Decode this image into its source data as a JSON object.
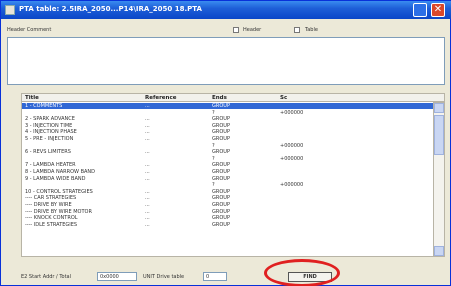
{
  "window": {
    "title": "PTA table: 2.5IRA_2050...P14\\IRA_2050 18.PTA",
    "close_glyph": "✕"
  },
  "header": {
    "comment_label": "Header Comment",
    "check1_label": "Header",
    "check2_label": "Table"
  },
  "table": {
    "columns": [
      "Title",
      "Reference",
      "Ends",
      "Sc"
    ],
    "rows": [
      {
        "title": "1 - COMMENTS",
        "ref": "...",
        "ends": "GROUP",
        "sc": "",
        "selected": true
      },
      {
        "title": "",
        "ref": "",
        "ends": "?",
        "sc": "+000000",
        "selected": false
      },
      {
        "title": "2 - SPARK ADVANCE",
        "ref": "...",
        "ends": "GROUP",
        "sc": "",
        "selected": false
      },
      {
        "title": "3 - INJECTION TIME",
        "ref": "...",
        "ends": "GROUP",
        "sc": "",
        "selected": false
      },
      {
        "title": "4 - INJECTION PHASE",
        "ref": "...",
        "ends": "GROUP",
        "sc": "",
        "selected": false
      },
      {
        "title": "5 - PRE - INJECTION",
        "ref": "...",
        "ends": "GROUP",
        "sc": "",
        "selected": false
      },
      {
        "title": "",
        "ref": "",
        "ends": "?",
        "sc": "+000000",
        "selected": false
      },
      {
        "title": "6 - REVS LIMITERS",
        "ref": "...",
        "ends": "GROUP",
        "sc": "",
        "selected": false
      },
      {
        "title": "",
        "ref": "",
        "ends": "?",
        "sc": "+000000",
        "selected": false
      },
      {
        "title": "7 - LAMBDA HEATER",
        "ref": "...",
        "ends": "GROUP",
        "sc": "",
        "selected": false
      },
      {
        "title": "8 - LAMBDA NARROW BAND",
        "ref": "...",
        "ends": "GROUP",
        "sc": "",
        "selected": false
      },
      {
        "title": "9 - LAMBDA WIDE BAND",
        "ref": "...",
        "ends": "GROUP",
        "sc": "",
        "selected": false
      },
      {
        "title": "",
        "ref": "",
        "ends": "?",
        "sc": "+000000",
        "selected": false
      },
      {
        "title": "10 - CONTROL STRATEGIES",
        "ref": "...",
        "ends": "GROUP",
        "sc": "",
        "selected": false
      },
      {
        "title": "---- CAR STRATEGIES",
        "ref": "...",
        "ends": "GROUP",
        "sc": "",
        "selected": false
      },
      {
        "title": "---- DRIVE BY WIRE",
        "ref": "...",
        "ends": "GROUP",
        "sc": "",
        "selected": false
      },
      {
        "title": "---- DRIVE BY WIRE MOTOR",
        "ref": "...",
        "ends": "GROUP",
        "sc": "",
        "selected": false
      },
      {
        "title": "---- KNOCK CONTROL",
        "ref": "...",
        "ends": "GROUP",
        "sc": "",
        "selected": false
      },
      {
        "title": "---- IDLE STRATEGIES",
        "ref": "...",
        "ends": "GROUP",
        "sc": "",
        "selected": false
      }
    ]
  },
  "footer": {
    "label1": "E2 Start Addr / Total",
    "input1": "0x0000",
    "label2": "UNIT Drive table",
    "input2": "0",
    "button_label": "FIND"
  },
  "colors": {
    "highlight": "#e02020",
    "selection": "#3168d5"
  }
}
